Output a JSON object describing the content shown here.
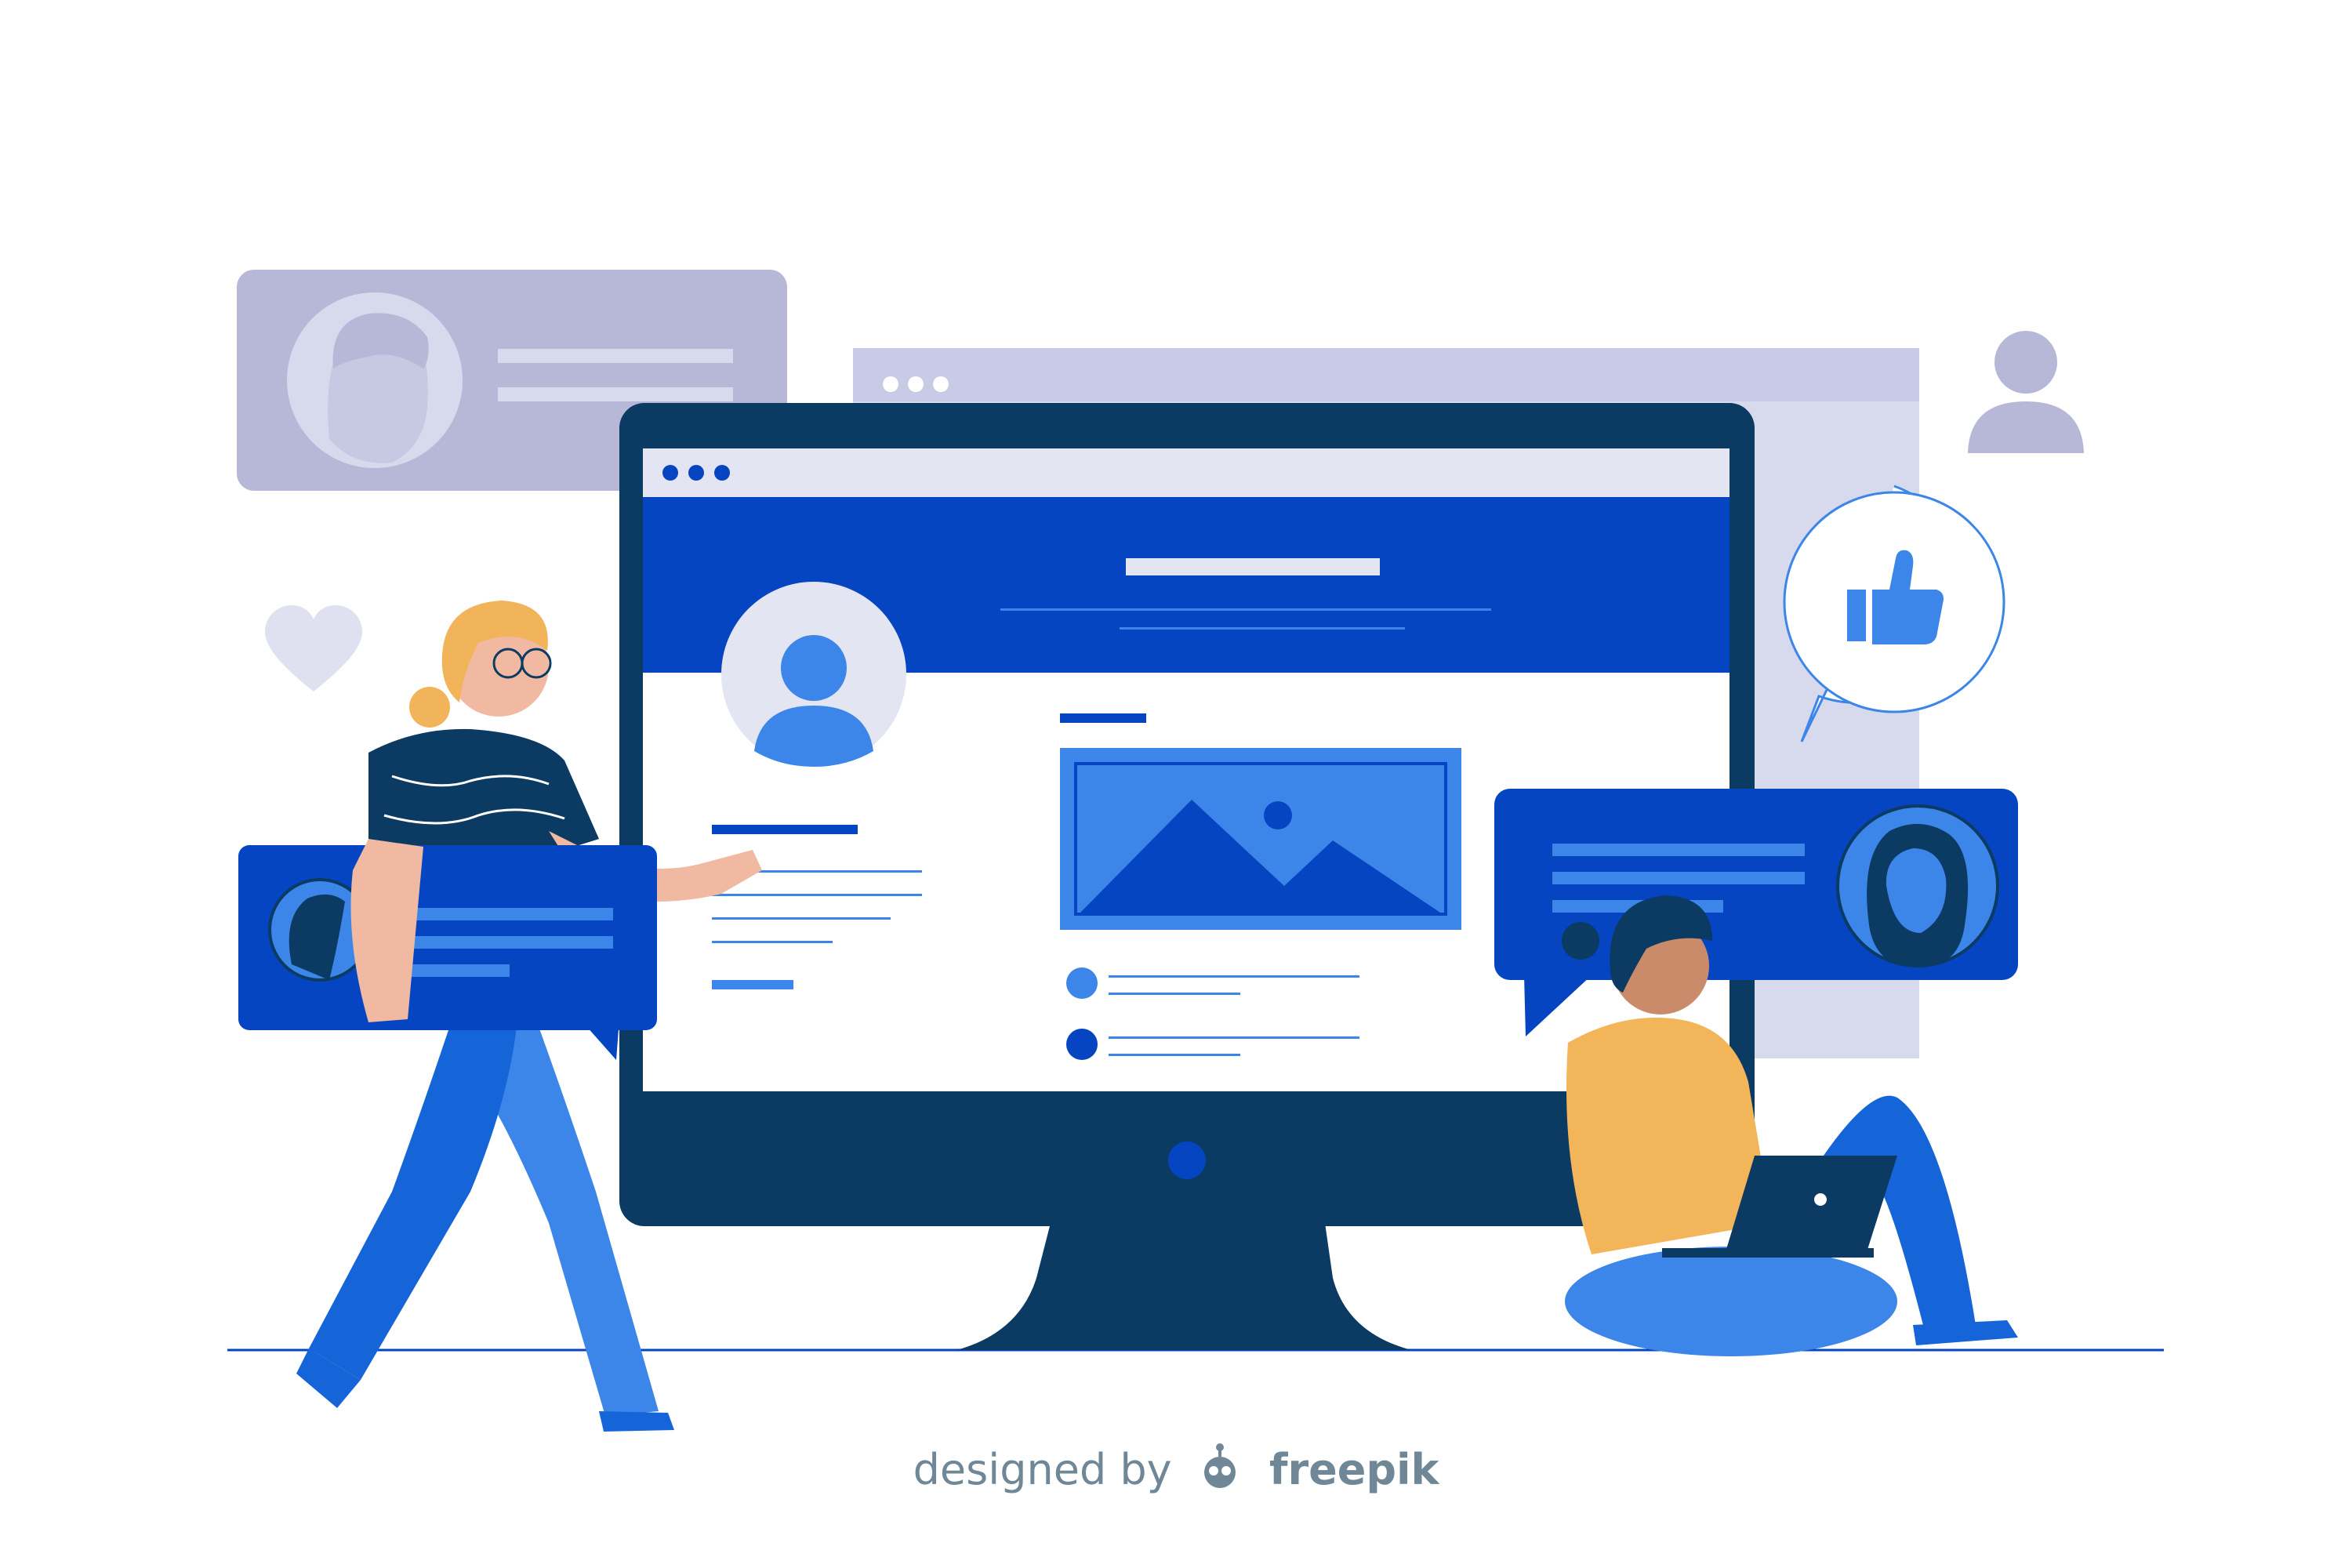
{
  "colors": {
    "navy": "#0b3a63",
    "royal_blue": "#0645c1",
    "bright_blue": "#3b86e8",
    "lavender": "#b7b8d8",
    "light_lavender": "#d7d9ed",
    "pale_lavender": "#e3e5f2",
    "skin": "#f1b9a2",
    "dark_skin": "#c98b6a",
    "hair_blonde": "#f2b45a",
    "shirt_yellow": "#f3b559",
    "credit_gray": "#6f8796"
  },
  "icons": [
    "heart-icon",
    "user-icon",
    "thumbs-up-icon",
    "image-icon",
    "freepik-logo-icon"
  ],
  "credit": {
    "prefix": "designed by",
    "brand": "freepik"
  }
}
